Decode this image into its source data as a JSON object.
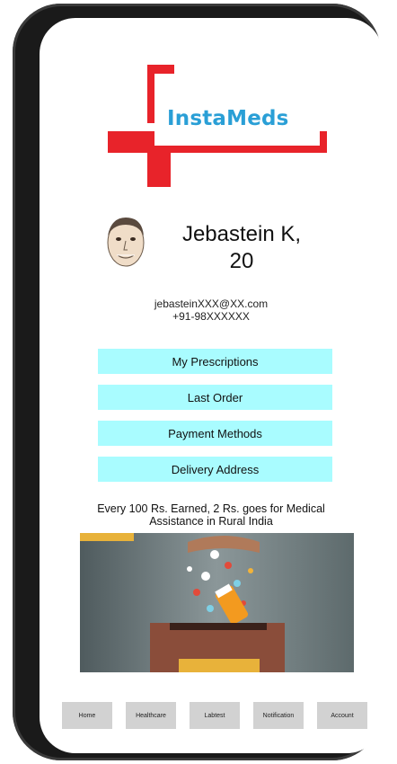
{
  "app": {
    "logo_text": "InstaMeds",
    "brand_red": "#e8232a",
    "brand_blue": "#2a9fd6"
  },
  "profile": {
    "name_line1": "Jebastein K,",
    "name_line2": "20",
    "email": "jebasteinXXX@XX.com",
    "phone": "+91-98XXXXXX",
    "avatar_icon": "person-portrait-icon"
  },
  "menu": {
    "accent": "#a9fcff",
    "items": [
      {
        "label": "My Prescriptions"
      },
      {
        "label": "Last Order"
      },
      {
        "label": "Payment Methods"
      },
      {
        "label": "Delivery Address"
      }
    ]
  },
  "charity": {
    "text_line1": "Every 100 Rs. Earned, 2 Rs. goes for Medical",
    "text_line2": "Assistance in Rural India",
    "image_icon": "medicine-donation-box-illustration"
  },
  "nav": {
    "items": [
      {
        "label": "Home"
      },
      {
        "label": "Healthcare"
      },
      {
        "label": "Labtest"
      },
      {
        "label": "Notification"
      },
      {
        "label": "Account"
      }
    ]
  }
}
